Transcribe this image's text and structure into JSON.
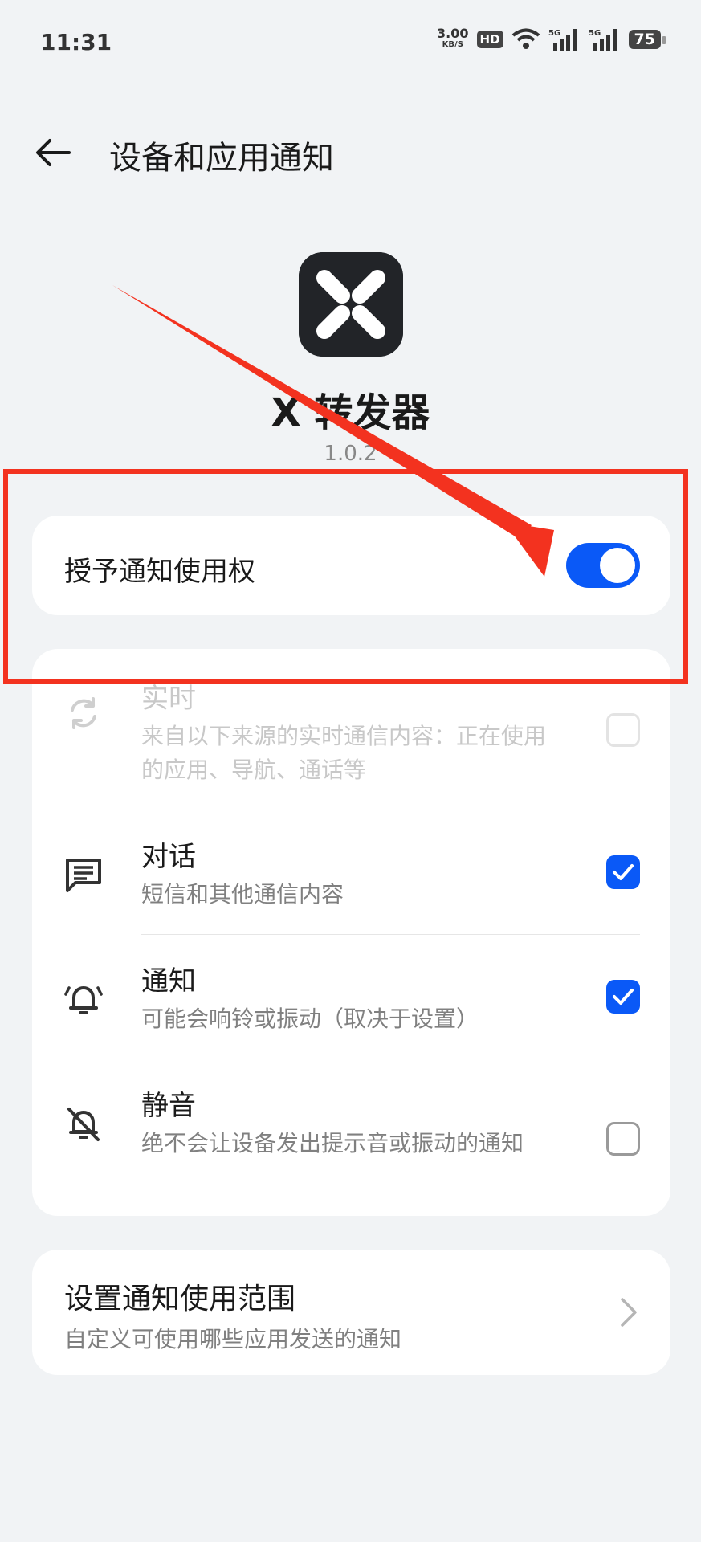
{
  "status_bar": {
    "time": "11:31",
    "net_speed": "3.00",
    "net_unit": "KB/S",
    "hd_label": "HD",
    "battery": "75"
  },
  "header": {
    "title": "设备和应用通知"
  },
  "app": {
    "name": "X 转发器",
    "version": "1.0.2"
  },
  "toggle": {
    "label": "授予通知使用权",
    "checked": true
  },
  "list": [
    {
      "title": "实时",
      "subtitle": "来自以下来源的实时通信内容：正在使用的应用、导航、通话等",
      "checked": false,
      "disabled": true,
      "icon": "sync-icon"
    },
    {
      "title": "对话",
      "subtitle": "短信和其他通信内容",
      "checked": true,
      "disabled": false,
      "icon": "message-icon"
    },
    {
      "title": "通知",
      "subtitle": "可能会响铃或振动（取决于设置）",
      "checked": true,
      "disabled": false,
      "icon": "bell-ringing-icon"
    },
    {
      "title": "静音",
      "subtitle": "绝不会让设备发出提示音或振动的通知",
      "checked": false,
      "disabled": false,
      "icon": "bell-off-icon"
    }
  ],
  "scope": {
    "title": "设置通知使用范围",
    "subtitle": "自定义可使用哪些应用发送的通知"
  },
  "colors": {
    "accent": "#0a59f7",
    "annotation": "#f3321f"
  }
}
